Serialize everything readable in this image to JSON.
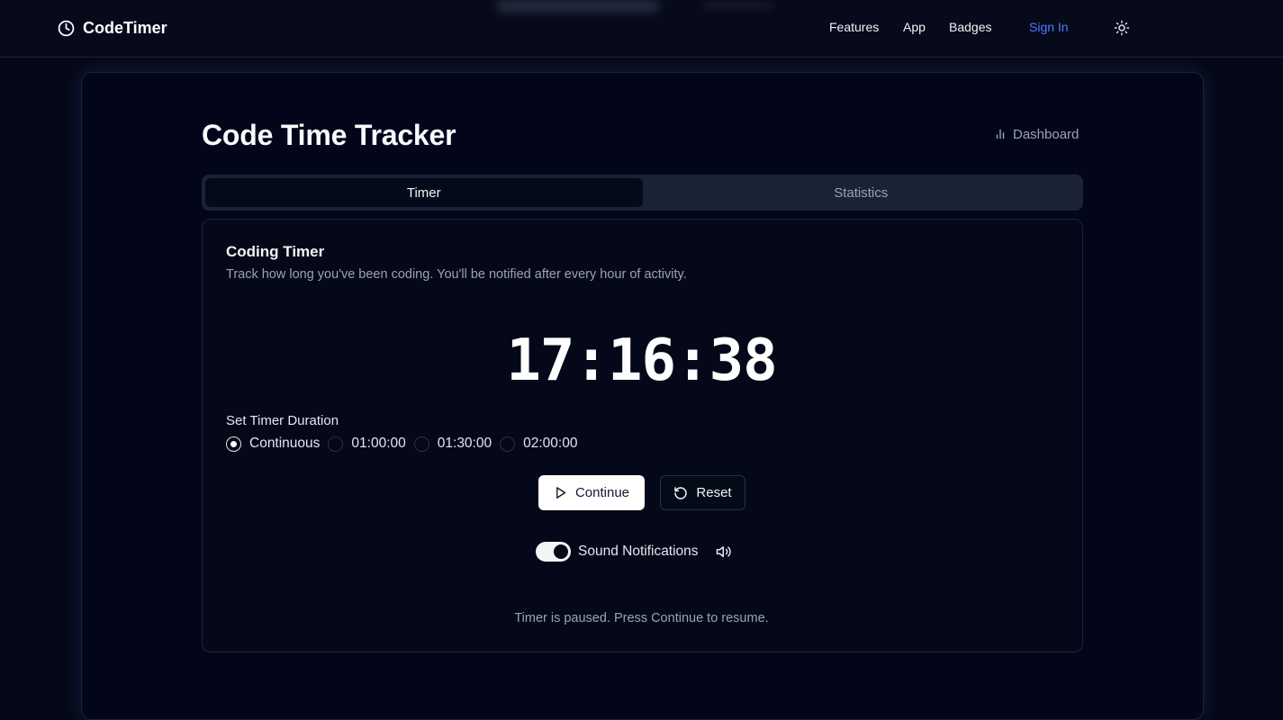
{
  "nav": {
    "brand": "CodeTimer",
    "links": [
      "Features",
      "App",
      "Badges"
    ],
    "sign_in": "Sign In"
  },
  "page": {
    "title": "Code Time Tracker",
    "dashboard_link": "Dashboard"
  },
  "tabs": [
    {
      "label": "Timer",
      "active": true
    },
    {
      "label": "Statistics",
      "active": false
    }
  ],
  "timer": {
    "title": "Coding Timer",
    "description": "Track how long you've been coding. You'll be notified after every hour of activity.",
    "hours": "17",
    "minutes": "16",
    "seconds": "38",
    "separator": ":",
    "duration_label": "Set Timer Duration",
    "duration_options": [
      {
        "label": "Continuous",
        "selected": true
      },
      {
        "label": "01:00:00",
        "selected": false
      },
      {
        "label": "01:30:00",
        "selected": false
      },
      {
        "label": "02:00:00",
        "selected": false
      }
    ],
    "continue_label": "Continue",
    "reset_label": "Reset",
    "sound_label": "Sound Notifications",
    "sound_enabled": true,
    "status": "Timer is paused. Press Continue to resume."
  },
  "colors": {
    "background": "#050816",
    "accent_link": "#4f7cff",
    "primary_button": "#ffffff"
  },
  "icons": {
    "brand": "clock-icon",
    "theme": "sun-icon",
    "dashboard": "bar-chart-icon",
    "continue": "play-icon",
    "reset": "rotate-ccw-icon",
    "sound": "volume-icon"
  }
}
